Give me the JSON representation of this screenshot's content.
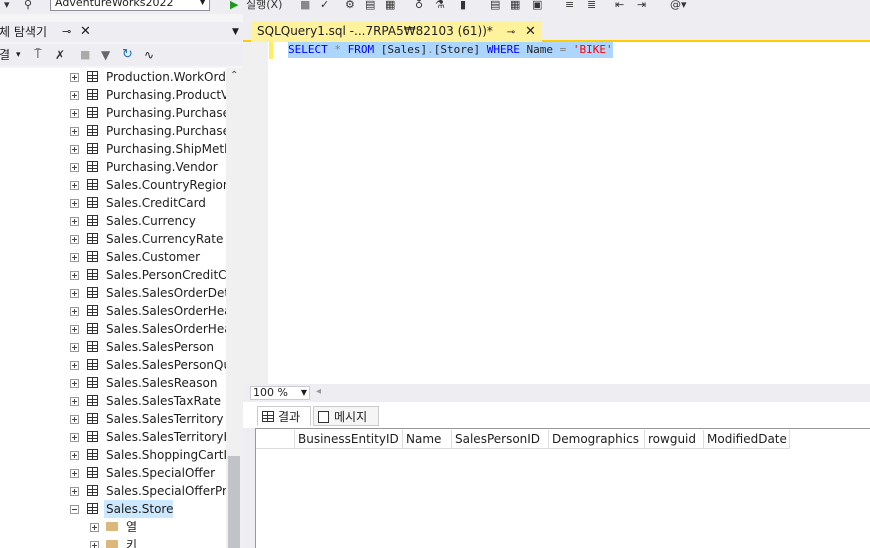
{
  "toolbar": {
    "database": "AdventureWorks2022",
    "execute_label": "실행(X)"
  },
  "explorer": {
    "title": "개체 탐색기",
    "connect_label": "연결"
  },
  "tree": {
    "rows": [
      {
        "label": "Production.WorkOrder",
        "kind": "table"
      },
      {
        "label": "Purchasing.ProductVe",
        "kind": "table"
      },
      {
        "label": "Purchasing.PurchaseO",
        "kind": "table"
      },
      {
        "label": "Purchasing.PurchaseO",
        "kind": "table"
      },
      {
        "label": "Purchasing.ShipMetho",
        "kind": "table"
      },
      {
        "label": "Purchasing.Vendor",
        "kind": "table"
      },
      {
        "label": "Sales.CountryRegionC",
        "kind": "table"
      },
      {
        "label": "Sales.CreditCard",
        "kind": "table"
      },
      {
        "label": "Sales.Currency",
        "kind": "table"
      },
      {
        "label": "Sales.CurrencyRate",
        "kind": "table"
      },
      {
        "label": "Sales.Customer",
        "kind": "table"
      },
      {
        "label": "Sales.PersonCreditCarc",
        "kind": "table"
      },
      {
        "label": "Sales.SalesOrderDetail",
        "kind": "table"
      },
      {
        "label": "Sales.SalesOrderHeade",
        "kind": "table"
      },
      {
        "label": "Sales.SalesOrderHeade",
        "kind": "table"
      },
      {
        "label": "Sales.SalesPerson",
        "kind": "table"
      },
      {
        "label": "Sales.SalesPersonQuot",
        "kind": "table"
      },
      {
        "label": "Sales.SalesReason",
        "kind": "table"
      },
      {
        "label": "Sales.SalesTaxRate",
        "kind": "table"
      },
      {
        "label": "Sales.SalesTerritory",
        "kind": "table"
      },
      {
        "label": "Sales.SalesTerritoryHis",
        "kind": "table"
      },
      {
        "label": "Sales.ShoppingCartIte",
        "kind": "table"
      },
      {
        "label": "Sales.SpecialOffer",
        "kind": "table"
      },
      {
        "label": "Sales.SpecialOfferProc",
        "kind": "table"
      },
      {
        "label": "Sales.Store",
        "kind": "table-open"
      },
      {
        "label": "열",
        "kind": "folder"
      },
      {
        "label": "키",
        "kind": "folder"
      }
    ]
  },
  "document": {
    "tab_title": "SQLQuery1.sql -...7RPA5₩82103 (61))*",
    "sql": {
      "select": "SELECT",
      "star": "*",
      "from": "FROM",
      "obj1": "[Sales]",
      "dot": ".",
      "obj2": "[Store]",
      "where": "WHERE",
      "col": "Name",
      "eq": "=",
      "literal": "'BIKE'"
    },
    "zoom": "100 %"
  },
  "results": {
    "tabs": [
      "결과",
      "메시지"
    ],
    "columns": [
      "BusinessEntityID",
      "Name",
      "SalesPersonID",
      "Demographics",
      "rowguid",
      "ModifiedDate"
    ]
  }
}
